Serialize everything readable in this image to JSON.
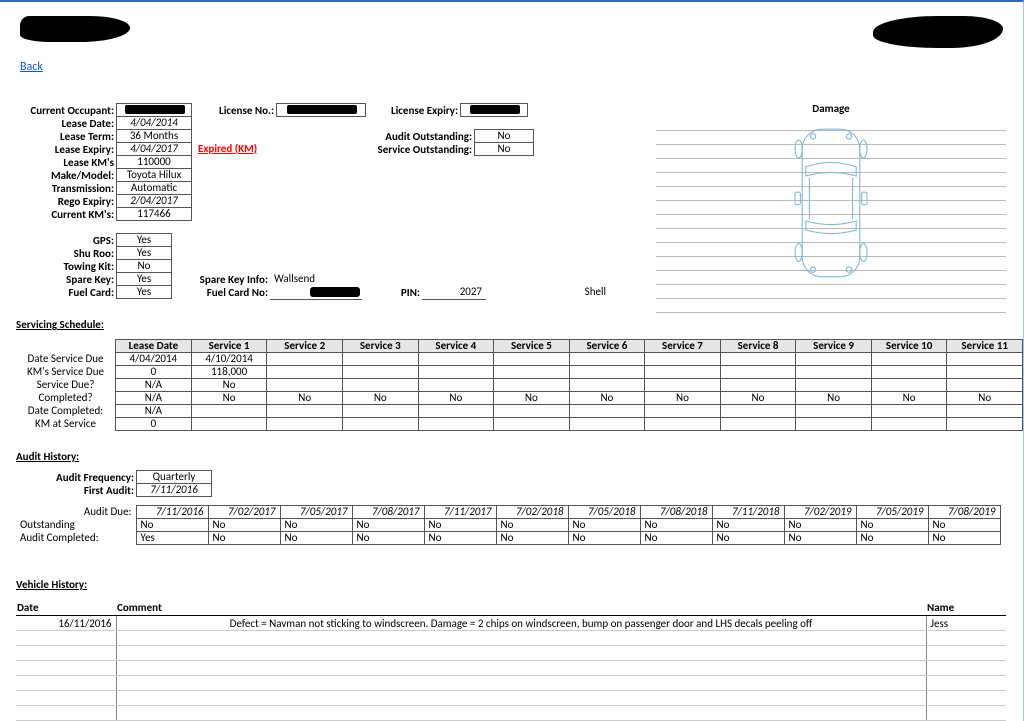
{
  "nav": {
    "back": "Back"
  },
  "vehicle": {
    "labels": {
      "current_occupant": "Current Occupant:",
      "lease_date": "Lease Date:",
      "lease_term": "Lease Term:",
      "lease_expiry": "Lease Expiry:",
      "lease_kms": "Lease KM's",
      "make_model": "Make/Model:",
      "transmission": "Transmission:",
      "rego_expiry": "Rego Expiry:",
      "current_kms": "Current KM's:",
      "gps": "GPS:",
      "shu_roo": "Shu Roo:",
      "towing_kit": "Towing Kit:",
      "spare_key": "Spare Key:",
      "fuel_card": "Fuel Card:",
      "license_no": "License No.:",
      "license_expiry": "License Expiry:",
      "audit_outstanding": "Audit Outstanding:",
      "service_outstanding": "Service Outstanding:",
      "spare_key_info": "Spare Key Info:",
      "fuel_card_no": "Fuel Card No:",
      "pin": "PIN:"
    },
    "current_occupant": "",
    "lease_date": "4/04/2014",
    "lease_term": "36 Months",
    "lease_expiry": "4/04/2017",
    "expired_flag": "Expired (KM)",
    "lease_kms": "110000",
    "make_model": "Toyota Hilux",
    "transmission": "Automatic",
    "rego_expiry": "2/04/2017",
    "current_kms": "117466",
    "gps": "Yes",
    "shu_roo": "Yes",
    "towing_kit": "No",
    "spare_key": "Yes",
    "fuel_card": "Yes",
    "license_no": "",
    "license_expiry": "",
    "audit_outstanding": "No",
    "service_outstanding": "No",
    "spare_key_info": "Wallsend",
    "fuel_card_no": "",
    "pin": "2027",
    "fuel_provider": "Shell"
  },
  "damage": {
    "title": "Damage"
  },
  "servicing": {
    "title": "Servicing Schedule:",
    "headers": [
      "",
      "Lease Date",
      "Service 1",
      "Service 2",
      "Service 3",
      "Service 4",
      "Service 5",
      "Service 6",
      "Service 7",
      "Service 8",
      "Service 9",
      "Service 10",
      "Service 11"
    ],
    "rows": [
      {
        "label": "Date Service Due",
        "cells": [
          "4/04/2014",
          "4/10/2014",
          "",
          "",
          "",
          "",
          "",
          "",
          "",
          "",
          "",
          ""
        ]
      },
      {
        "label": "KM's Service Due",
        "cells": [
          "0",
          "118,000",
          "",
          "",
          "",
          "",
          "",
          "",
          "",
          "",
          "",
          ""
        ]
      },
      {
        "label": "Service Due?",
        "cells": [
          "N/A",
          "No",
          "",
          "",
          "",
          "",
          "",
          "",
          "",
          "",
          "",
          ""
        ]
      },
      {
        "label": "Completed?",
        "cells": [
          "N/A",
          "No",
          "No",
          "No",
          "No",
          "No",
          "No",
          "No",
          "No",
          "No",
          "No",
          "No"
        ]
      },
      {
        "label": "Date Completed:",
        "cells": [
          "N/A",
          "",
          "",
          "",
          "",
          "",
          "",
          "",
          "",
          "",
          "",
          ""
        ]
      },
      {
        "label": "KM at Service",
        "cells": [
          "0",
          "",
          "",
          "",
          "",
          "",
          "",
          "",
          "",
          "",
          "",
          ""
        ]
      }
    ]
  },
  "audit": {
    "title": "Audit History:",
    "freq_label": "Audit Frequency:",
    "freq": "Quarterly",
    "first_label": "First Audit:",
    "first": "7/11/2016",
    "due_label": "Audit Due:",
    "outstanding_label": "Outstanding",
    "completed_label": "Audit Completed:",
    "dates": [
      "7/11/2016",
      "7/02/2017",
      "7/05/2017",
      "7/08/2017",
      "7/11/2017",
      "7/02/2018",
      "7/05/2018",
      "7/08/2018",
      "7/11/2018",
      "7/02/2019",
      "7/05/2019",
      "7/08/2019"
    ],
    "outstanding": [
      "No",
      "No",
      "No",
      "No",
      "No",
      "No",
      "No",
      "No",
      "No",
      "No",
      "No",
      "No"
    ],
    "completed": [
      "Yes",
      "No",
      "No",
      "No",
      "No",
      "No",
      "No",
      "No",
      "No",
      "No",
      "No",
      "No"
    ]
  },
  "vehicle_history": {
    "title": "Vehicle History:",
    "headers": {
      "date": "Date",
      "comment": "Comment",
      "name": "Name"
    },
    "rows": [
      {
        "date": "16/11/2016",
        "comment": "Defect = Navman not sticking to windscreen. Damage = 2 chips on windscreen, bump on passenger door and LHS decals peeling off",
        "name": "Jess"
      },
      {
        "date": "",
        "comment": "",
        "name": ""
      },
      {
        "date": "",
        "comment": "",
        "name": ""
      },
      {
        "date": "",
        "comment": "",
        "name": ""
      },
      {
        "date": "",
        "comment": "",
        "name": ""
      },
      {
        "date": "",
        "comment": "",
        "name": ""
      },
      {
        "date": "",
        "comment": "",
        "name": ""
      }
    ]
  }
}
